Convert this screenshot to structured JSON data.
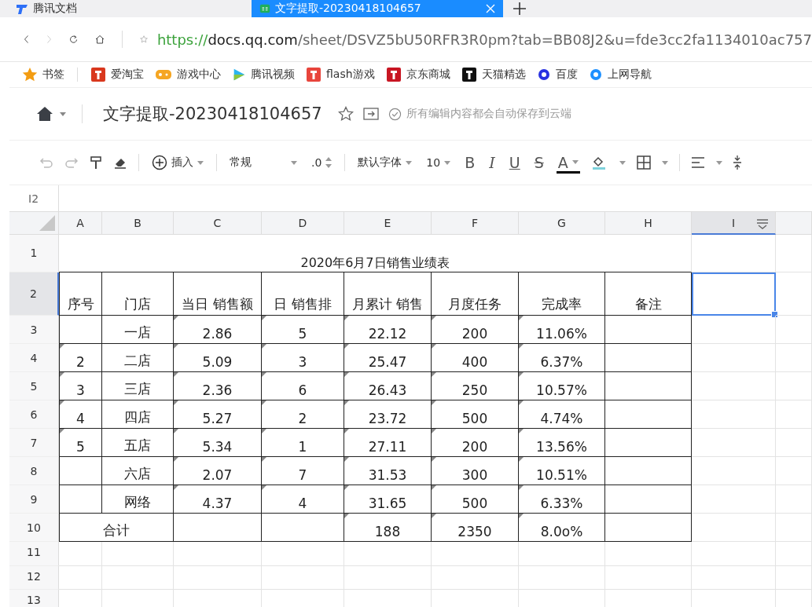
{
  "browser": {
    "tabs": [
      {
        "title": "腾讯文档",
        "selected": false
      },
      {
        "title": "文字提取-20230418104657",
        "selected": true
      }
    ],
    "url": {
      "scheme": "https://",
      "host": "docs.qq.com",
      "path": "/sheet/DSVZ5bU50RFR3R0pm?tab=BB08J2&u=fde3cc2fa1134010ac757"
    },
    "bookmarks": [
      {
        "label": "书签"
      },
      {
        "label": "爱淘宝"
      },
      {
        "label": "游戏中心"
      },
      {
        "label": "腾讯视频"
      },
      {
        "label": "flash游戏"
      },
      {
        "label": "京东商城"
      },
      {
        "label": "天猫精选"
      },
      {
        "label": "百度"
      },
      {
        "label": "上网导航"
      }
    ]
  },
  "document": {
    "title": "文字提取-20230418104657",
    "save_status": "所有编辑内容都会自动保存到云端"
  },
  "toolbar": {
    "insert": "插入",
    "number_format": "常规",
    "decimals": ".0",
    "font": "默认字体",
    "font_size": "10",
    "format_buttons": [
      {
        "kind": "bold",
        "label": "B"
      },
      {
        "kind": "italic",
        "label": "I"
      },
      {
        "kind": "underline",
        "label": "U"
      },
      {
        "kind": "strike",
        "label": "S"
      },
      {
        "kind": "color",
        "label": "A"
      }
    ]
  },
  "sheet": {
    "name_box": "I2",
    "columns": [
      {
        "label": "A",
        "selected": false
      },
      {
        "label": "B",
        "selected": false
      },
      {
        "label": "C",
        "selected": false
      },
      {
        "label": "D",
        "selected": false
      },
      {
        "label": "E",
        "selected": false
      },
      {
        "label": "F",
        "selected": false
      },
      {
        "label": "G",
        "selected": false
      },
      {
        "label": "H",
        "selected": false
      },
      {
        "label": "I",
        "selected": true
      }
    ],
    "rows": [
      {
        "label": "1",
        "selected": false,
        "kind": "title",
        "cells": [
          {
            "kind": "title",
            "text": "2020年6月7日销售业绩表",
            "flag": false
          }
        ]
      },
      {
        "label": "2",
        "selected": true,
        "kind": "data",
        "cells": [
          {
            "text": "序号",
            "flag": false
          },
          {
            "text": "门店",
            "flag": false
          },
          {
            "text": "当日 销售额",
            "flag": false
          },
          {
            "text": "日 销售排",
            "flag": false
          },
          {
            "text": "月累计 销售",
            "flag": false
          },
          {
            "text": "月度任务",
            "flag": false
          },
          {
            "text": "完成率",
            "flag": false
          },
          {
            "text": "备注",
            "flag": false
          }
        ]
      },
      {
        "label": "3",
        "selected": false,
        "kind": "data",
        "cells": [
          {
            "flag": false
          },
          {
            "text": "一店",
            "flag": false
          },
          {
            "text": "2.86",
            "flag": true
          },
          {
            "text": "5",
            "flag": true
          },
          {
            "text": "22.12",
            "flag": true
          },
          {
            "text": "200",
            "flag": true
          },
          {
            "text": "11.06%",
            "flag": true
          },
          {
            "flag": false
          }
        ]
      },
      {
        "label": "4",
        "selected": false,
        "kind": "data",
        "cells": [
          {
            "text": "2",
            "flag": true
          },
          {
            "text": "二店",
            "flag": false
          },
          {
            "text": "5.09",
            "flag": true
          },
          {
            "text": "3",
            "flag": true
          },
          {
            "text": "25.47",
            "flag": true
          },
          {
            "text": "400",
            "flag": true
          },
          {
            "text": "6.37%",
            "flag": true
          },
          {
            "flag": false
          }
        ]
      },
      {
        "label": "5",
        "selected": false,
        "kind": "data",
        "cells": [
          {
            "text": "3",
            "flag": true
          },
          {
            "text": "三店",
            "flag": false
          },
          {
            "text": "2.36",
            "flag": true
          },
          {
            "text": "6",
            "flag": true
          },
          {
            "text": "26.43",
            "flag": true
          },
          {
            "text": "250",
            "flag": true
          },
          {
            "text": "10.57%",
            "flag": true
          },
          {
            "flag": false
          }
        ]
      },
      {
        "label": "6",
        "selected": false,
        "kind": "data",
        "cells": [
          {
            "text": "4",
            "flag": true
          },
          {
            "text": "四店",
            "flag": false
          },
          {
            "text": "5.27",
            "flag": true
          },
          {
            "text": "2",
            "flag": true
          },
          {
            "text": "23.72",
            "flag": true
          },
          {
            "text": "500",
            "flag": true
          },
          {
            "text": "4.74%",
            "flag": true
          },
          {
            "flag": false
          }
        ]
      },
      {
        "label": "7",
        "selected": false,
        "kind": "data",
        "cells": [
          {
            "text": "5",
            "flag": true
          },
          {
            "text": "五店",
            "flag": false
          },
          {
            "text": "5.34",
            "flag": true
          },
          {
            "text": "1",
            "flag": true
          },
          {
            "text": "27.11",
            "flag": true
          },
          {
            "text": "200",
            "flag": true
          },
          {
            "text": "13.56%",
            "flag": true
          },
          {
            "flag": false
          }
        ]
      },
      {
        "label": "8",
        "selected": false,
        "kind": "data",
        "cells": [
          {
            "flag": false
          },
          {
            "text": "六店",
            "flag": false
          },
          {
            "text": "2.07",
            "flag": true
          },
          {
            "text": "7",
            "flag": true
          },
          {
            "text": "31.53",
            "flag": true
          },
          {
            "text": "300",
            "flag": true
          },
          {
            "text": "10.51%",
            "flag": true
          },
          {
            "flag": false
          }
        ]
      },
      {
        "label": "9",
        "selected": false,
        "kind": "data",
        "cells": [
          {
            "flag": false
          },
          {
            "text": "网络",
            "flag": false
          },
          {
            "text": "4.37",
            "flag": true
          },
          {
            "text": "4",
            "flag": true
          },
          {
            "text": "31.65",
            "flag": true
          },
          {
            "text": "500",
            "flag": true
          },
          {
            "text": "6.33%",
            "flag": true
          },
          {
            "flag": false
          }
        ]
      },
      {
        "label": "10",
        "selected": false,
        "kind": "data",
        "cells": [
          {
            "kind": "pair",
            "text": "合计",
            "flag": false
          },
          {
            "flag": false
          },
          {
            "flag": false
          },
          {
            "text": "188",
            "flag": true
          },
          {
            "text": "2350",
            "flag": true
          },
          {
            "text": "8.0o%",
            "flag": true
          },
          {
            "flag": false
          }
        ]
      },
      {
        "label": "11",
        "selected": false,
        "kind": "blank"
      },
      {
        "label": "12",
        "selected": false,
        "kind": "blank"
      },
      {
        "label": "13",
        "selected": false,
        "kind": "blank"
      }
    ]
  }
}
